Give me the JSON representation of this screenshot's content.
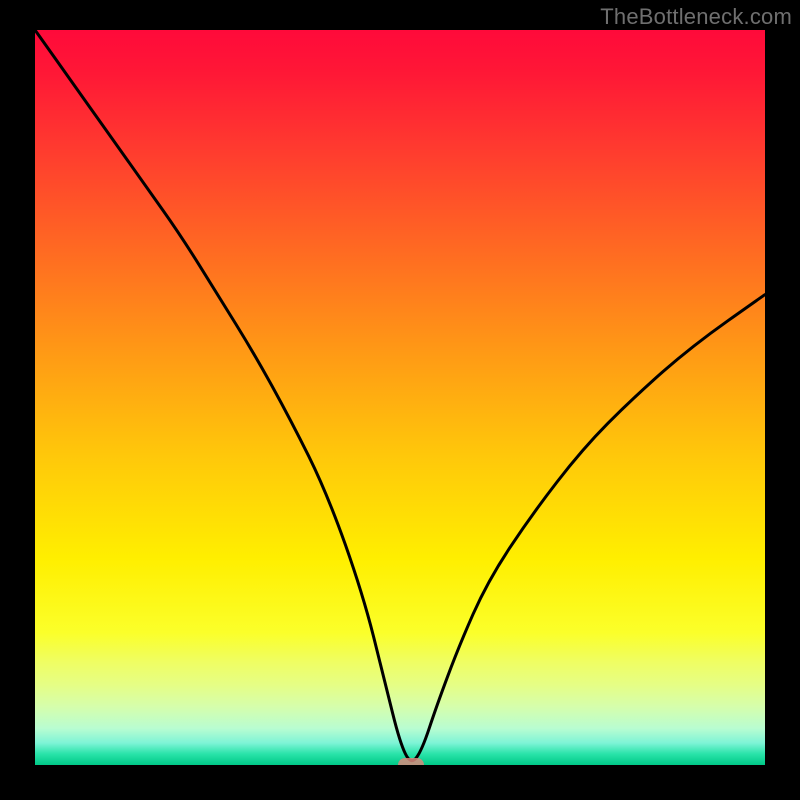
{
  "watermark": "TheBottleneck.com",
  "colors": {
    "curve_stroke": "#000000",
    "marker_fill": "#d98a7c"
  },
  "chart_data": {
    "type": "line",
    "title": "",
    "xlabel": "",
    "ylabel": "",
    "xlim": [
      0,
      100
    ],
    "ylim": [
      0,
      100
    ],
    "grid": false,
    "series": [
      {
        "name": "bottleneck-curve",
        "x": [
          0,
          5,
          10,
          15,
          20,
          25,
          30,
          35,
          40,
          45,
          48,
          50,
          51.5,
          53,
          55,
          58,
          62,
          68,
          75,
          82,
          90,
          100
        ],
        "values": [
          100,
          93,
          86,
          79,
          72,
          64,
          56,
          47,
          37,
          23,
          11,
          3,
          0,
          2,
          8,
          16,
          25,
          34,
          43,
          50,
          57,
          64
        ]
      }
    ],
    "marker": {
      "x": 51.5,
      "y": 0
    }
  }
}
